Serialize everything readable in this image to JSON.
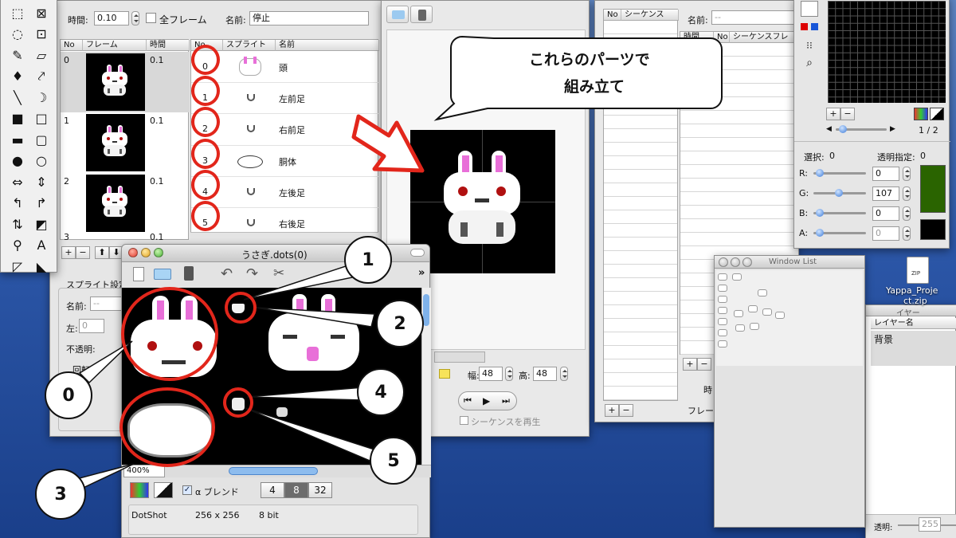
{
  "frame_window": {
    "time_label": "時間:",
    "time_value": "0.10",
    "all_frames_label": "全フレーム",
    "name_label": "名前:",
    "name_value": "停止",
    "frame_table": {
      "columns": [
        "No",
        "フレーム",
        "時間"
      ],
      "rows": [
        {
          "no": "0",
          "time": "0.1"
        },
        {
          "no": "1",
          "time": "0.1"
        },
        {
          "no": "2",
          "time": "0.1"
        },
        {
          "no": "3",
          "time": "0.1"
        }
      ]
    },
    "sprite_table": {
      "columns": [
        "No",
        "スプライト",
        "名前"
      ],
      "rows": [
        {
          "no": "0",
          "name": "頭"
        },
        {
          "no": "1",
          "name": "左前足"
        },
        {
          "no": "2",
          "name": "右前足"
        },
        {
          "no": "3",
          "name": "胴体"
        },
        {
          "no": "4",
          "name": "左後足"
        },
        {
          "no": "5",
          "name": "右後足"
        }
      ]
    },
    "add_label": "+",
    "remove_label": "−",
    "sprite_settings_label": "スプライト設定",
    "sprite_name_label": "名前:",
    "sprite_name_value": "--",
    "left_label": "左:",
    "left_value": "0",
    "opacity_label": "不透明:",
    "rotation_label": "回転:"
  },
  "preview_window": {
    "width_label": "幅:",
    "width_value": "48",
    "height_label": "高:",
    "height_value": "48",
    "play_sequence_label": "シーケンスを再生"
  },
  "sequence_window": {
    "columns": [
      "No",
      "シーケンス"
    ],
    "name_label": "名前:",
    "name_value": "--",
    "sub_columns": [
      "時間",
      "No",
      "シーケンスフレ"
    ],
    "time_label": "時",
    "frame_label": "フレー"
  },
  "palette_window": {
    "page_label": "1 / 2",
    "selection_label": "選択:",
    "selection_value": "0",
    "transparent_label": "透明指定:",
    "transparent_value": "0",
    "r_label": "R:",
    "r_value": "0",
    "g_label": "G:",
    "g_value": "107",
    "b_label": "B:",
    "b_value": "0",
    "a_label": "A:",
    "a_value": "0",
    "swatch_color": "#2a6400"
  },
  "dots_window": {
    "title": "うさぎ.dots(0)",
    "zoom_value": "400%",
    "alpha_blend_label": "α ブレンド",
    "bit_options": [
      "4",
      "8",
      "32"
    ],
    "selected_bit": "8",
    "info_name": "DotShot",
    "info_size": "256 x 256",
    "info_depth": "8 bit"
  },
  "window_list": {
    "title": "Window List"
  },
  "layer_window": {
    "title_fragment": "イヤー",
    "column": "レイヤー名",
    "row": "背景",
    "transparency_label": "透明:",
    "transparency_value": "255"
  },
  "desktop": {
    "file_name_line1": "Yappa_Proje",
    "file_name_line2": "ct.zip",
    "file_badge": "ZIP"
  },
  "annotations": {
    "bubble_line1": "これらのパーツで",
    "bubble_line2": "組み立て",
    "callouts": [
      "0",
      "1",
      "2",
      "3",
      "4",
      "5"
    ]
  },
  "colors": {
    "accent_red": "#e2261b",
    "bunny_pink": "#e86fd8",
    "bunny_eye": "#b01010"
  }
}
